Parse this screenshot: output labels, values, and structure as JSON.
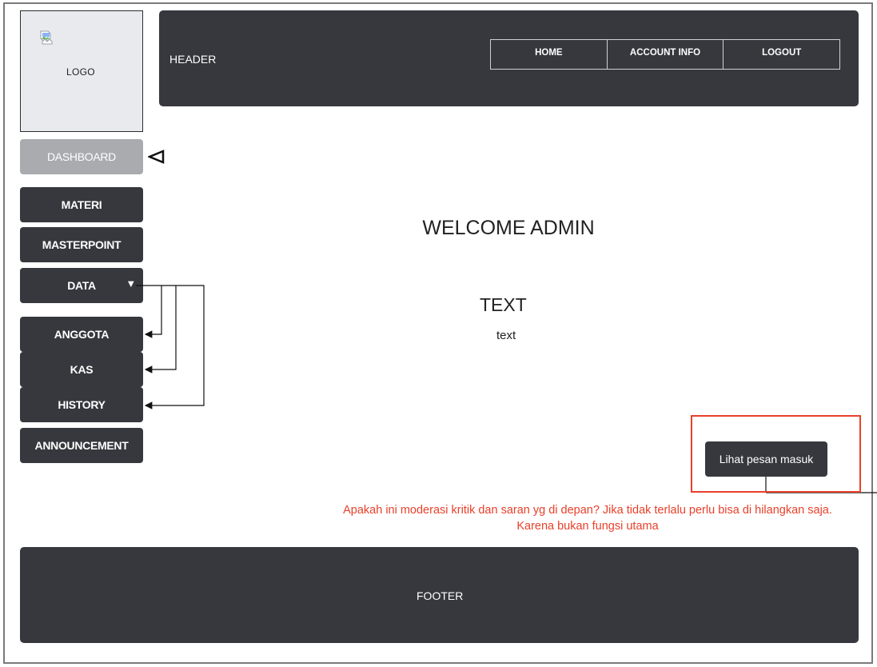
{
  "logo": {
    "label": "LOGO"
  },
  "header": {
    "title": "HEADER",
    "nav": [
      {
        "label": "HOME"
      },
      {
        "label": "ACCOUNT INFO"
      },
      {
        "label": "LOGOUT"
      }
    ]
  },
  "sidebar": {
    "items": [
      {
        "label": "DASHBOARD",
        "active": true
      },
      {
        "label": "MATERI"
      },
      {
        "label": "MASTERPOINT"
      },
      {
        "label": "DATA",
        "icon": "triangle-down-icon"
      },
      {
        "label": "ANGGOTA"
      },
      {
        "label": "KAS"
      },
      {
        "label": "HISTORY"
      },
      {
        "label": "ANNOUNCEMENT"
      }
    ]
  },
  "main": {
    "welcome": "WELCOME ADMIN",
    "heading": "TEXT",
    "body": "text",
    "messages_button": "Lihat pesan masuk"
  },
  "annotation": {
    "comment": "Apakah ini moderasi kritik dan saran yg di depan? Jika tidak terlalu perlu bisa di hilangkan saja. Karena bukan fungsi utama"
  },
  "footer": {
    "title": "FOOTER"
  },
  "colors": {
    "dark": "#36383d",
    "active": "#a9abae",
    "annotation": "#e8402a",
    "logo_bg": "#e8eaed"
  }
}
